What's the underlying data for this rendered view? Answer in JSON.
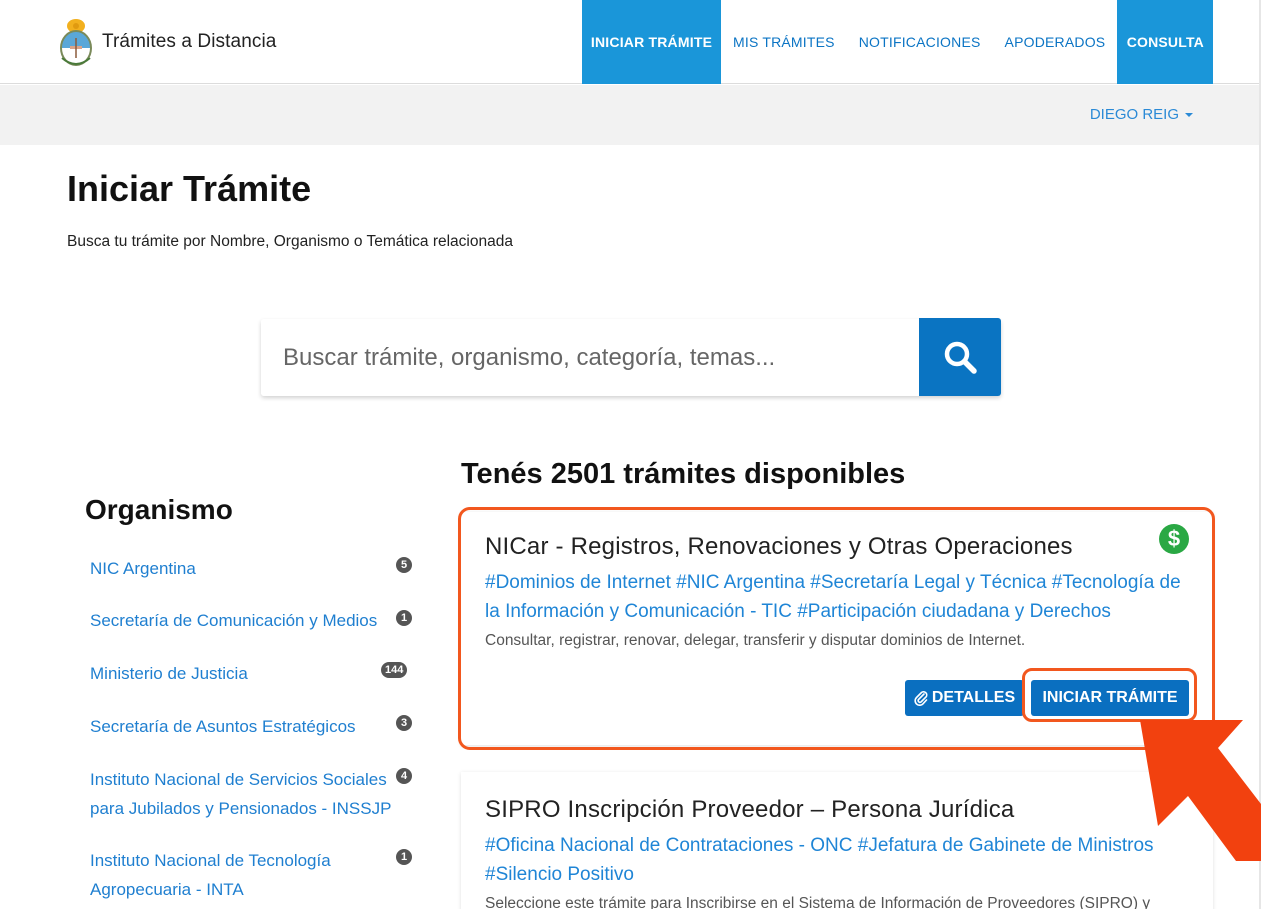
{
  "header": {
    "brand": "Trámites a Distancia",
    "nav": [
      {
        "label": "INICIAR TRÁMITE",
        "active": true
      },
      {
        "label": "MIS TRÁMITES",
        "active": false
      },
      {
        "label": "NOTIFICACIONES",
        "active": false
      },
      {
        "label": "APODERADOS",
        "active": false
      },
      {
        "label": "CONSULTA",
        "active": true
      }
    ],
    "user": "DIEGO REIG"
  },
  "page": {
    "title": "Iniciar Trámite",
    "subtitle": "Busca tu trámite por Nombre, Organismo o Temática relacionada"
  },
  "search": {
    "placeholder": "Buscar trámite, organismo, categoría, temas...",
    "icon": "search-icon"
  },
  "sidebar": {
    "title": "Organismo",
    "items": [
      {
        "label": "NIC Argentina",
        "count": "5"
      },
      {
        "label": "Secretaría de Comunicación y Medios",
        "count": "1"
      },
      {
        "label": "Ministerio de Justicia",
        "count": "144"
      },
      {
        "label": "Secretaría de Asuntos Estratégicos",
        "count": "3"
      },
      {
        "label": "Instituto Nacional de Servicios Sociales para Jubilados y Pensionados - INSSJP",
        "count": "4"
      },
      {
        "label": "Instituto Nacional de Tecnología Agropecuaria - INTA",
        "count": "1"
      }
    ]
  },
  "results": {
    "heading": "Tenés 2501 trámites disponibles",
    "cards": [
      {
        "title": "NICar - Registros, Renovaciones y Otras Operaciones",
        "tags": "#Dominios de Internet #NIC Argentina #Secretaría Legal y Técnica #Tecnología de la Información y Comunicación - TIC #Participación ciudadana y Derechos",
        "description": "Consultar, registrar, renovar, delegar, transferir y disputar dominios de Internet.",
        "details_label": "DETALLES",
        "start_label": "INICIAR TRÁMITE",
        "paid": true
      },
      {
        "title": "SIPRO Inscripción Proveedor – Persona Jurídica",
        "tags": "#Oficina Nacional de Contrataciones - ONC #Jefatura de Gabinete de Ministros #Silencio Positivo",
        "description": "Seleccione este trámite para Inscribirse en el Sistema de Información de Proveedores (SIPRO) y"
      }
    ]
  },
  "colors": {
    "accent": "#1a96d9",
    "primary_button": "#0a6fc0",
    "link": "#1f7fd0",
    "highlight": "#f2571e",
    "paid_badge": "#2aa844"
  }
}
